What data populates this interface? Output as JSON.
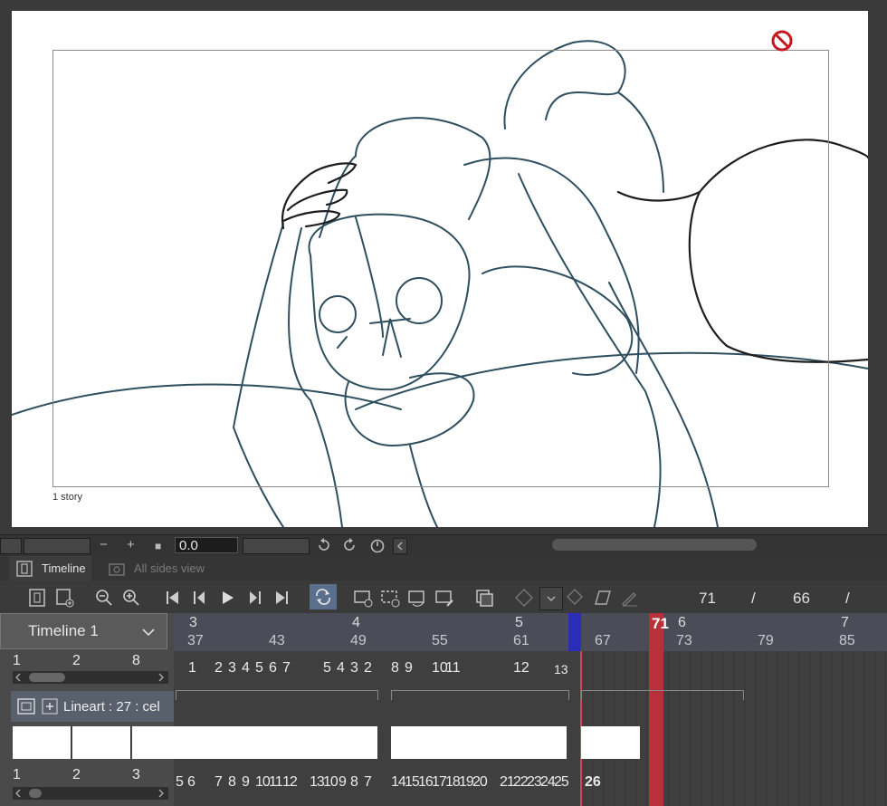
{
  "canvas": {
    "frame_label": "1 story"
  },
  "statusbar": {
    "zoom_out": "−",
    "zoom_in": "+",
    "square": "■",
    "angle_value": "0.0"
  },
  "tabs": [
    {
      "label": "Timeline",
      "active": true
    },
    {
      "label": "All sides view",
      "active": false
    }
  ],
  "toolbar": {
    "current_frame": "71",
    "separator1": "/",
    "total_frames": "66",
    "separator2": "/"
  },
  "left_panel": {
    "timeline_name": "Timeline 1",
    "row1": [
      "1",
      "2",
      "8"
    ],
    "layer_name": "Lineart : 27 : cel",
    "row2": [
      "1",
      "2",
      "3"
    ]
  },
  "ruler": {
    "seconds": [
      "3",
      "4",
      "5",
      "6",
      "7"
    ],
    "frames": [
      "37",
      "43",
      "49",
      "55",
      "61",
      "67",
      "73",
      "79",
      "85"
    ],
    "current": "71"
  },
  "cells_top": [
    "1",
    "2",
    "3",
    "4",
    "5",
    "6",
    "7",
    "5",
    "4",
    "3",
    "2",
    "8",
    "9",
    "10",
    "11",
    "12",
    "13"
  ],
  "cells_bottom": [
    "5",
    "6",
    "7",
    "8",
    "9",
    "10",
    "11",
    "12",
    "13",
    "10",
    "9",
    "8",
    "7",
    "14",
    "15",
    "16",
    "17",
    "18",
    "19",
    "20",
    "21",
    "22",
    "23",
    "24",
    "25",
    "26"
  ],
  "colors": {
    "accent_blue": "#2b2fb8",
    "accent_red": "#b8303a",
    "sketch_line": "#2f4f5f"
  }
}
